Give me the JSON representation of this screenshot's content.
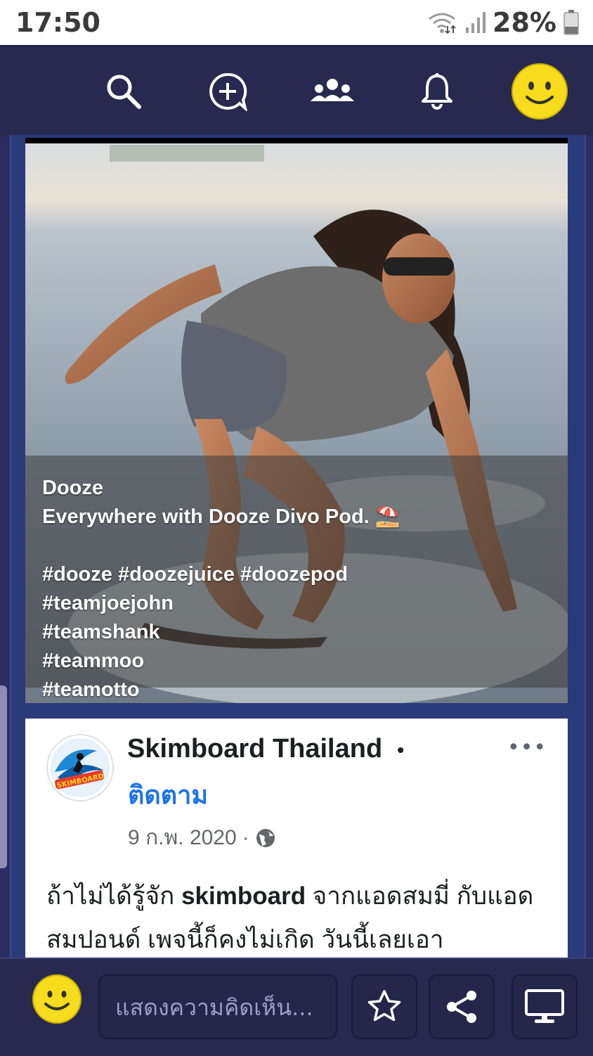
{
  "status_bar": {
    "time": "17:50",
    "battery": "28%"
  },
  "top_nav": {
    "icons": [
      "search-icon",
      "add-post-icon",
      "people-icon",
      "bell-icon",
      "profile-avatar"
    ]
  },
  "post_image": {
    "caption_title": "Dooze",
    "caption_line": "Everywhere with Dooze Divo Pod.",
    "caption_emoji": "⛱️",
    "hashtags_1": "#dooze #doozejuice #doozepod",
    "hashtags_2": "#teamjoejohn",
    "hashtags_3": "#teamshank",
    "hashtags_4": "#teammoo",
    "hashtags_5": "#teamotto"
  },
  "fb_post": {
    "page_name": "Skimboard Thailand",
    "dot": "•",
    "follow": "ติดตาม",
    "more": "•••",
    "date": "9 ก.พ. 2020",
    "meta_sep": "·",
    "text_pre": "ถ้าไม่ได้รู้จัก ",
    "text_bold": "skimboard",
    "text_post": " จากแอดสมมี่ กับแอดสมปอนด์ เพจนี้ก็คงไม่เกิด วันนี้เลยเอา"
  },
  "bottom_bar": {
    "comment_placeholder": "แสดงความคิดเห็น...",
    "icons": [
      "star-icon",
      "share-icon",
      "monitor-icon"
    ]
  },
  "colors": {
    "nav_bg": "#27294f",
    "feed_bg": "#2a3b7a",
    "avatar": "#f6dc1c",
    "link": "#1b74e4"
  }
}
